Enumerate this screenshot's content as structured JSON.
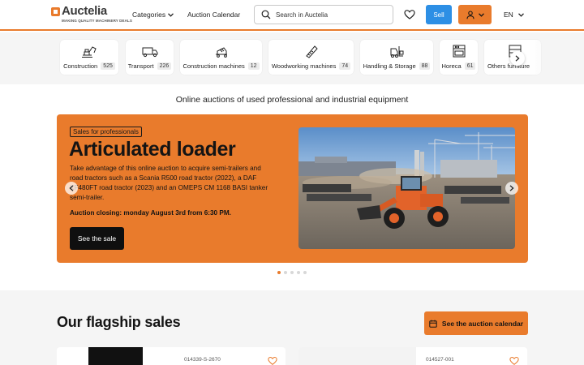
{
  "brand": {
    "name": "Auctelia",
    "tagline": "MAKING QUALITY MACHINERY DEALS"
  },
  "nav": {
    "categories": "Categories",
    "calendar": "Auction Calendar"
  },
  "search": {
    "placeholder": "Search in Auctelia"
  },
  "header": {
    "sell": "Sell",
    "lang": "EN"
  },
  "categories": [
    {
      "label": "Construction",
      "count": "525",
      "icon": "excavator-icon"
    },
    {
      "label": "Transport",
      "count": "226",
      "icon": "truck-icon"
    },
    {
      "label": "Construction machines",
      "count": "12",
      "icon": "concrete-mixer-icon"
    },
    {
      "label": "Woodworking machines",
      "count": "74",
      "icon": "saw-icon"
    },
    {
      "label": "Handling & Storage",
      "count": "88",
      "icon": "forklift-icon"
    },
    {
      "label": "Horeca",
      "count": "61",
      "icon": "oven-icon"
    },
    {
      "label": "Others furniture",
      "count": "",
      "icon": "shelf-icon"
    }
  ],
  "tagline": "Online auctions of used professional and industrial equipment",
  "hero": {
    "badge": "Sales for professionals",
    "title": "Articulated loader",
    "description": "Take advantage of this online auction to acquire semi-trailers and road tractors such as a Scania R500 road tractor (2022), a DAF XF480FT road tractor (2023) and an OMEPS CM 1168 BASI tanker semi-trailer.",
    "closing": "Auction closing: monday August 3rd from 6:30 PM.",
    "cta": "See the sale"
  },
  "carousel": {
    "slides": 5,
    "active": 1
  },
  "flagship": {
    "title": "Our flagship sales",
    "calendar_btn": "See the auction calendar",
    "cards": [
      {
        "ref": "014339-S-2670"
      },
      {
        "ref": "014527-001"
      }
    ]
  },
  "colors": {
    "brand": "#e97b2c",
    "sell": "#2d8fe5",
    "dark": "#141414"
  }
}
